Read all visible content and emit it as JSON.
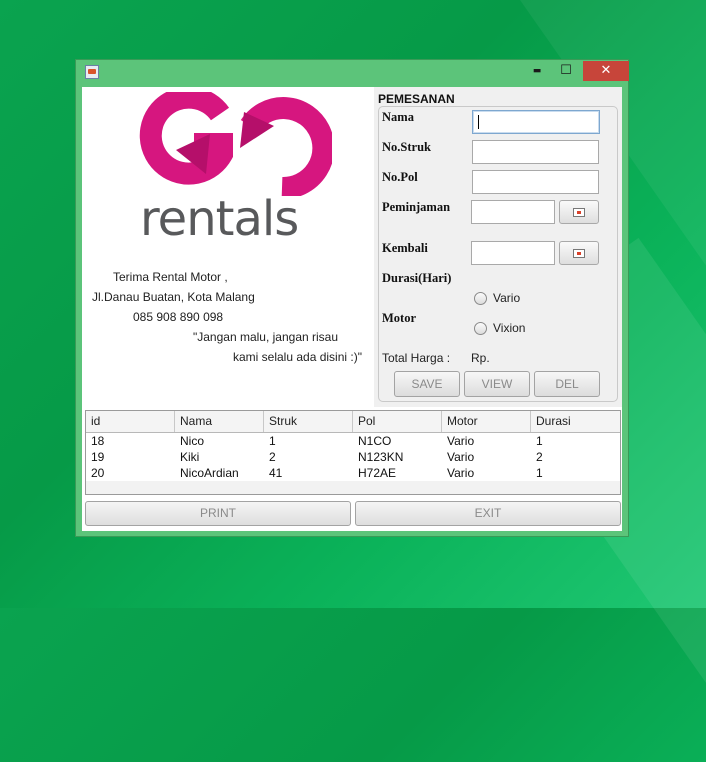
{
  "window": {
    "title": "",
    "controls": {
      "minimize": "▬",
      "maximize": "☐",
      "close": "✕"
    }
  },
  "brand": {
    "logo_text": "GO",
    "name": "rentals",
    "colors": {
      "magenta": "#d6167f",
      "gray": "#58595b"
    }
  },
  "info": {
    "line1": "Terima Rental Motor ,",
    "line2": "Jl.Danau Buatan, Kota Malang",
    "line3": "085 908 890 098",
    "line4": "\"Jangan malu, jangan risau",
    "line5": "kami selalu ada disini :)\""
  },
  "form": {
    "title": "PEMESANAN",
    "nama_label": "Nama",
    "struk_label": "No.Struk",
    "pol_label": "No.Pol",
    "peminjaman_label": "Peminjaman",
    "kembali_label": "Kembali",
    "durasi_label": "Durasi(Hari)",
    "motor_label": "Motor",
    "motor_options": [
      "Vario",
      "Vixion"
    ],
    "total_label": "Total Harga :",
    "total_value": "Rp.",
    "buttons": {
      "save": "SAVE",
      "view": "VIEW",
      "del": "DEL"
    }
  },
  "table": {
    "columns": [
      "id",
      "Nama",
      "Struk",
      "Pol",
      "Motor",
      "Durasi"
    ],
    "rows": [
      [
        "18",
        "Nico",
        "1",
        "N1CO",
        "Vario",
        "1"
      ],
      [
        "19",
        "Kiki",
        "2",
        "N123KN",
        "Vario",
        "2"
      ],
      [
        "20",
        "NicoArdian",
        "41",
        "H72AE",
        "Vario",
        "1"
      ]
    ]
  },
  "footer": {
    "print": "PRINT",
    "exit": "EXIT"
  }
}
